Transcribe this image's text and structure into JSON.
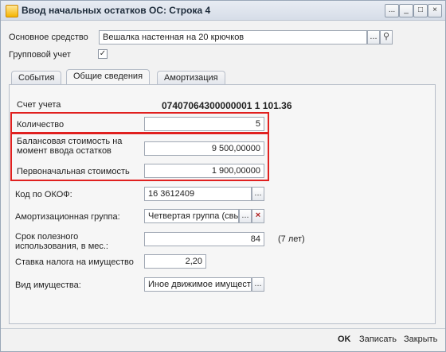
{
  "window": {
    "title": "Ввод начальных остатков ОС: Строка 4"
  },
  "titlebar": {
    "more_icon": "...",
    "minimize": "_",
    "maximize": "□",
    "close": "×"
  },
  "header": {
    "asset_label": "Основное средство",
    "asset_value": "Вешалка   настенная на 20 крючков",
    "select_glyph": "...",
    "search_glyph": "⚲",
    "group_label": "Групповой учет",
    "group_checked": true,
    "check_glyph": "✓"
  },
  "tabs": [
    {
      "label": "События"
    },
    {
      "label": "Общие сведения"
    },
    {
      "label": "Амортизация"
    }
  ],
  "general": {
    "account_label": "Счет учета",
    "account_value": "07407064300000001  1  101.36",
    "quantity_label": "Количество",
    "quantity_value": "5",
    "balance_label_1": "Балансовая стоимость на",
    "balance_label_2": "момент ввода остатков",
    "balance_value": "9 500,00000",
    "initial_label": "Первоначальная стоимость",
    "initial_value": "1 900,00000",
    "okof_label": "Код по ОКОФ:",
    "okof_value": "16 3612409",
    "dep_group_label": "Амортизационная группа:",
    "dep_group_value": "Четвертая группа (свы",
    "clear_glyph": "×",
    "life_label_1": "Срок полезного",
    "life_label_2": "использования, в мес.:",
    "life_value": "84",
    "life_years": "(7 лет)",
    "tax_label": "Ставка налога на имущество",
    "tax_value": "2,20",
    "property_label": "Вид имущества:",
    "property_value": "Иное движимое имущест"
  },
  "footer": {
    "ok": "OK",
    "save": "Записать",
    "close": "Закрыть"
  },
  "colors": {
    "highlight": "#e0201f",
    "titlebar": "#d6dde8"
  }
}
